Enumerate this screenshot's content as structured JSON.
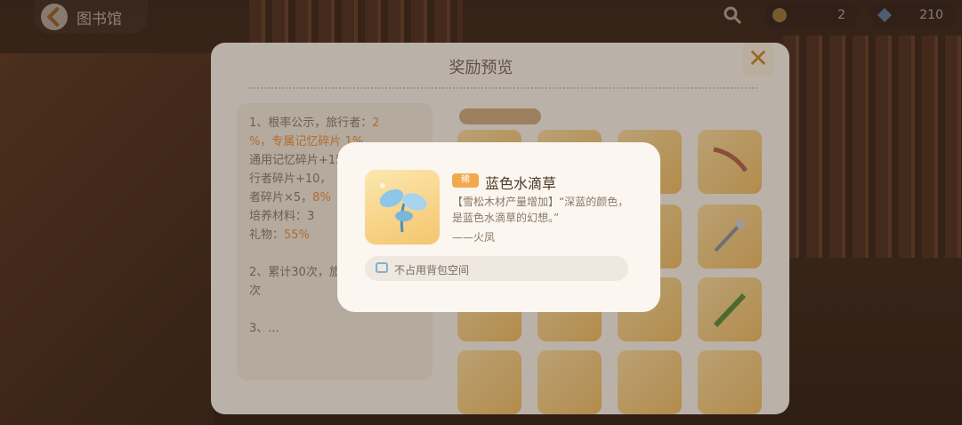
{
  "header": {
    "back_label": "图书馆",
    "resources": [
      {
        "icon": "leaf-token-icon",
        "value": "2"
      },
      {
        "icon": "blue-gem-icon",
        "value": "210"
      }
    ]
  },
  "panel": {
    "title": "奖励预览",
    "rules_text": {
      "p1_a": "1、根率公示，旅行者：",
      "p1_b": "2",
      "p1_c": "%，专属记忆碎片 1%，",
      "p1_d": "通用记忆碎片+15",
      "p1_e": "行者碎片+10，",
      "p1_f": "者碎片×5，",
      "p1_g": "8%",
      "p1_h": "培养材料：3",
      "p1_i": "礼物：",
      "p1_j": "55%",
      "p2": "2、累计30次，旅行者，剩下一次",
      "p3": "3、..."
    }
  },
  "dialog": {
    "badge": "稀",
    "item_name": "蓝色水滴草",
    "description": "【雪松木材产量增加】“深蓝的颜色，是蓝色水滴草的幻想。”",
    "author": "——火凤",
    "bag_note": "不占用背包空间"
  },
  "colors": {
    "accent_orange": "#e88a3c",
    "item_bg": "#f4c56e",
    "panel_bg": "#f3ece2"
  }
}
